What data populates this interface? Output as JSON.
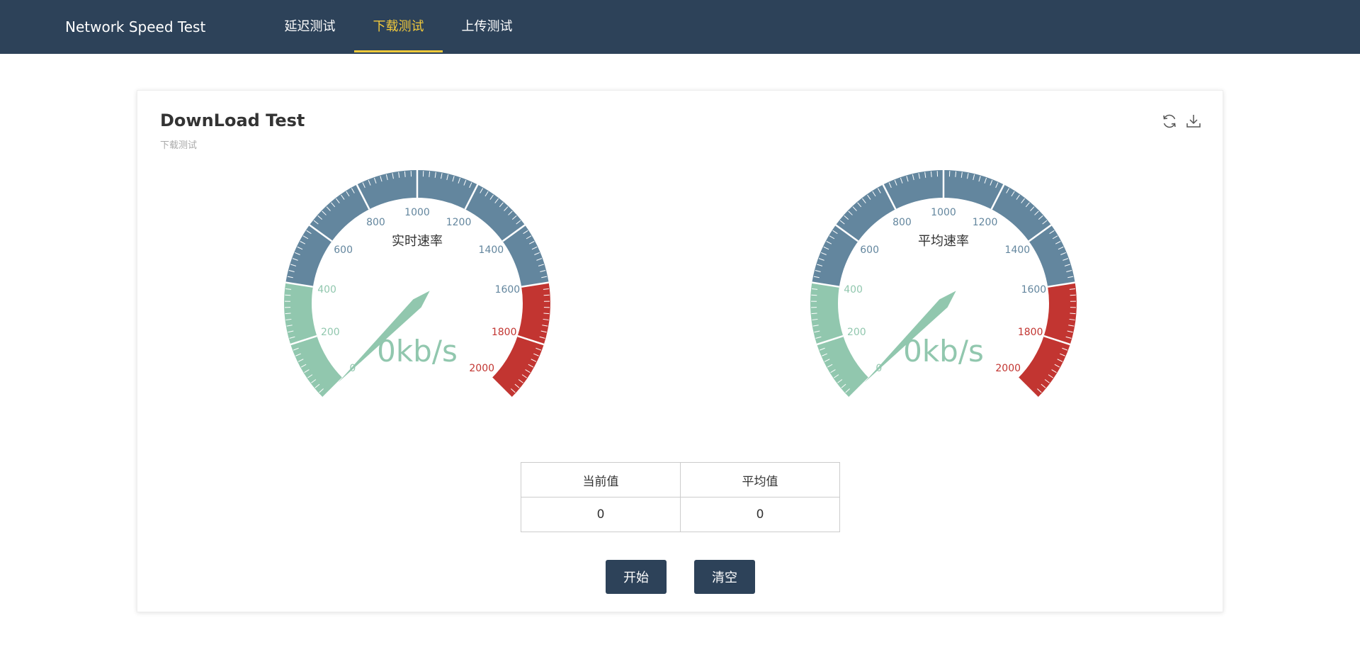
{
  "navbar": {
    "brand": "Network Speed Test",
    "tabs": [
      {
        "label": "延迟测试",
        "active": false
      },
      {
        "label": "下载测试",
        "active": true
      },
      {
        "label": "上传测试",
        "active": false
      }
    ],
    "accent_color": "#f1c93b",
    "background_color": "#2d4259"
  },
  "card": {
    "title": "DownLoad Test",
    "subtitle": "下载测试",
    "tools": [
      {
        "name": "refresh-icon"
      },
      {
        "name": "download-icon"
      }
    ]
  },
  "gauges": [
    {
      "title": "实时速率",
      "value": 0,
      "display": "0kb/s"
    },
    {
      "title": "平均速率",
      "value": 0,
      "display": "0kb/s"
    }
  ],
  "gauge_scale": {
    "min": 0,
    "max": 2000,
    "tick_labels": [
      "0",
      "200",
      "400",
      "600",
      "800",
      "1000",
      "1200",
      "1400",
      "1600",
      "1800",
      "2000"
    ],
    "bands": [
      {
        "upto": 0.2,
        "color": "#91c7ae"
      },
      {
        "upto": 0.8,
        "color": "#63869e"
      },
      {
        "upto": 1.0,
        "color": "#c23531"
      }
    ]
  },
  "table": {
    "headers": [
      "当前值",
      "平均值"
    ],
    "values": [
      "0",
      "0"
    ]
  },
  "buttons": {
    "start": "开始",
    "clear": "清空"
  }
}
